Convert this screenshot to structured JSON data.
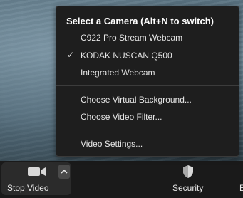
{
  "camera_menu": {
    "header": "Select a Camera (Alt+N to switch)",
    "cameras": [
      {
        "label": "C922 Pro Stream Webcam",
        "selected": false
      },
      {
        "label": "KODAK NUSCAN Q500",
        "selected": true
      },
      {
        "label": "Integrated Webcam",
        "selected": false
      }
    ],
    "check_glyph": "✓",
    "virtual_background_label": "Choose Virtual Background...",
    "video_filter_label": "Choose Video Filter...",
    "video_settings_label": "Video Settings..."
  },
  "toolbar": {
    "stop_video_label": "Stop Video",
    "security_label": "Security",
    "edge_label": "E"
  },
  "icons": {
    "camera": "video-camera-icon",
    "caret": "chevron-up-icon",
    "security": "shield-icon"
  },
  "colors": {
    "menu_background": "#1e1e1e",
    "toolbar_background": "#1a1a1a",
    "text": "#e6e6e6"
  }
}
